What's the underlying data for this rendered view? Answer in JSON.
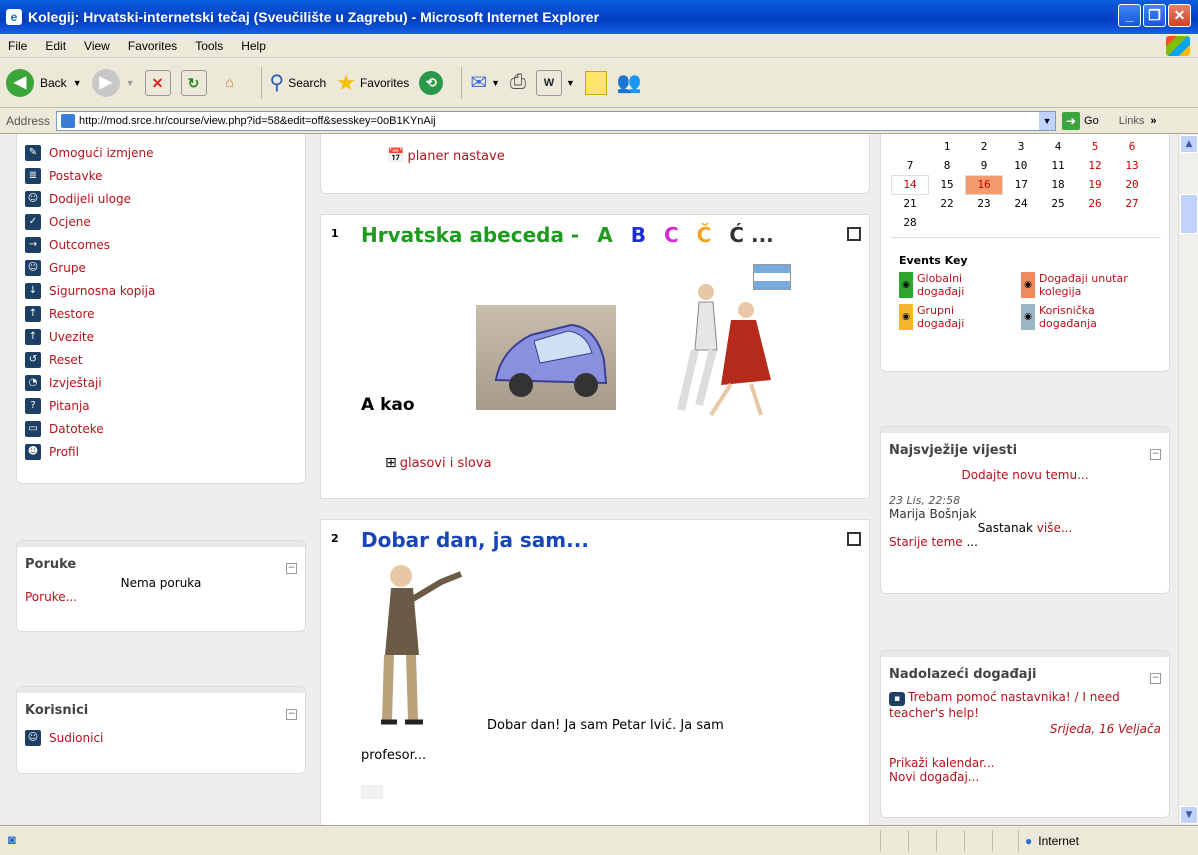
{
  "window": {
    "title": "Kolegij: Hrvatski-internetski tečaj (Sveučilište u Zagrebu) - Microsoft Internet Explorer"
  },
  "menu": [
    "File",
    "Edit",
    "View",
    "Favorites",
    "Tools",
    "Help"
  ],
  "toolbar": {
    "back": "Back",
    "search": "Search",
    "favorites": "Favorites"
  },
  "address": {
    "label": "Address",
    "url": "http://mod.srce.hr/course/view.php?id=58&edit=off&sesskey=0oB1KYnAij",
    "go": "Go",
    "links": "Links"
  },
  "admin": {
    "items": [
      {
        "label": "Omogući izmjene",
        "icon": "edit-icon"
      },
      {
        "label": "Postavke",
        "icon": "settings-icon"
      },
      {
        "label": "Dodijeli uloge",
        "icon": "roles-icon"
      },
      {
        "label": "Ocjene",
        "icon": "grades-icon"
      },
      {
        "label": "Outcomes",
        "icon": "outcomes-icon"
      },
      {
        "label": "Grupe",
        "icon": "groups-icon"
      },
      {
        "label": "Sigurnosna kopija",
        "icon": "backup-icon"
      },
      {
        "label": "Restore",
        "icon": "restore-icon"
      },
      {
        "label": "Uvezite",
        "icon": "import-icon"
      },
      {
        "label": "Reset",
        "icon": "reset-icon"
      },
      {
        "label": "Izvještaji",
        "icon": "reports-icon"
      },
      {
        "label": "Pitanja",
        "icon": "questions-icon"
      },
      {
        "label": "Datoteke",
        "icon": "files-icon"
      },
      {
        "label": "Profil",
        "icon": "profile-icon"
      }
    ]
  },
  "messages": {
    "title": "Poruke",
    "empty": "Nema poruka",
    "link": "Poruke..."
  },
  "people": {
    "title": "Korisnici",
    "participants": "Sudionici"
  },
  "section0": {
    "link": "planer nastave"
  },
  "section1": {
    "num": "1",
    "title": "Hrvatska abeceda -",
    "letters": [
      {
        "t": "A",
        "c": "#1e9a1e"
      },
      {
        "t": "B",
        "c": "#1a2fd6"
      },
      {
        "t": "C",
        "c": "#d62ad6"
      },
      {
        "t": "Č",
        "c": "#f0a51c"
      },
      {
        "t": "Ć ...",
        "c": "#333333"
      }
    ],
    "akao": "A kao",
    "link": "glasovi i slova"
  },
  "section2": {
    "num": "2",
    "title": "Dobar dan, ja sam...",
    "text1": "Dobar dan! Ja sam Petar Ivić. Ja sam",
    "text2": "profesor..."
  },
  "calendar": {
    "rows": [
      [
        "",
        "1",
        "2",
        "3",
        "4",
        "5",
        "6"
      ],
      [
        "7",
        "8",
        "9",
        "10",
        "11",
        "12",
        "13"
      ],
      [
        "14",
        "15",
        "16",
        "17",
        "18",
        "19",
        "20"
      ],
      [
        "21",
        "22",
        "23",
        "24",
        "25",
        "26",
        "27"
      ],
      [
        "28",
        "",
        "",
        "",
        "",
        "",
        ""
      ]
    ],
    "today": "16"
  },
  "events_key": {
    "title": "Events Key",
    "items": [
      {
        "label": "Globalni događaji",
        "color": "#2fa62f"
      },
      {
        "label": "Događaji unutar kolegija",
        "color": "#f08a5d"
      },
      {
        "label": "Grupni događaji",
        "color": "#f5b52b"
      },
      {
        "label": "Korisnička događanja",
        "color": "#9db6c6"
      }
    ]
  },
  "news": {
    "title": "Najsvježije vijesti",
    "add": "Dodajte novu temu...",
    "date": "23 Lis, 22:58",
    "author": "Marija Bošnjak",
    "subject": "Sastanak",
    "more": "više...",
    "older": "Starije teme",
    "older_suffix": "..."
  },
  "upcoming": {
    "title": "Nadolazeći događaji",
    "event": "Trebam pomoć nastavnika! / I need teacher's help!",
    "date": "Srijeda, 16 Veljača",
    "calendar": "Prikaži kalendar...",
    "new": "Novi događaj..."
  },
  "status": {
    "zone": "Internet"
  }
}
